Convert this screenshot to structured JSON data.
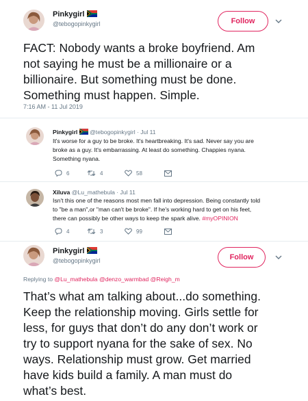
{
  "tweet1": {
    "name": "Pinkygirl",
    "handle": "@tebogopinkygirl",
    "follow_label": "Follow",
    "lines": [
      "FACT: Nobody wants a broke boyfriend. Am",
      "not saying he must be a millionaire or a",
      "billionaire. But something must be done.",
      "Something must happen. Simple."
    ],
    "timestamp": "7:16 AM - 11 Jul 2019"
  },
  "reply1": {
    "name": "Pinkygirl",
    "handle_time": "@tebogopinkygirl · Jul 11",
    "lines": [
      "It's worse for a guy to be broke. It's heartbreaking. It's sad. Never say you are",
      "broke as a guy. It's embarrassing. At least do something. Chappies nyana.",
      "Something nyana."
    ],
    "replies": "6",
    "retweets": "4",
    "likes": "58"
  },
  "reply2": {
    "name": "Xiluva",
    "handle_time": "@Lu_mathebula · Jul 11",
    "lines": [
      "Isn't this one of the reasons most men fall into depression. Being constantly told",
      "to \"be a man\",or \"man can't be broke\".  If he's working hard to get on his feet,",
      "there can possibly be other ways to keep the spark alive."
    ],
    "hashtag": "#myOPINION",
    "replies": "4",
    "retweets": "3",
    "likes": "99"
  },
  "tweet2": {
    "name": "Pinkygirl",
    "handle": "@tebogopinkygirl",
    "follow_label": "Follow",
    "replying_label": "Replying to",
    "mentions": [
      "@Lu_mathebula",
      "@denzo_warmbad",
      "@Reigh_m"
    ],
    "lines": [
      "That’s what am talking about...do something.",
      "Keep the relationship moving. Girls settle for",
      "less, for guys that don’t do any don’t work or",
      "try to support nyana for the sake of sex. No",
      "ways. Relationship must grow. Get married",
      "have kids build a family. A man must do",
      "what’s best."
    ]
  },
  "colors": {
    "accent": "#e0245e",
    "text": "#14171a",
    "muted": "#657786",
    "divider": "#e6ecf0"
  },
  "icons": [
    "reply-icon",
    "retweet-icon",
    "like-icon",
    "dm-icon",
    "chevron-down-icon",
    "south-africa-flag-icon"
  ]
}
